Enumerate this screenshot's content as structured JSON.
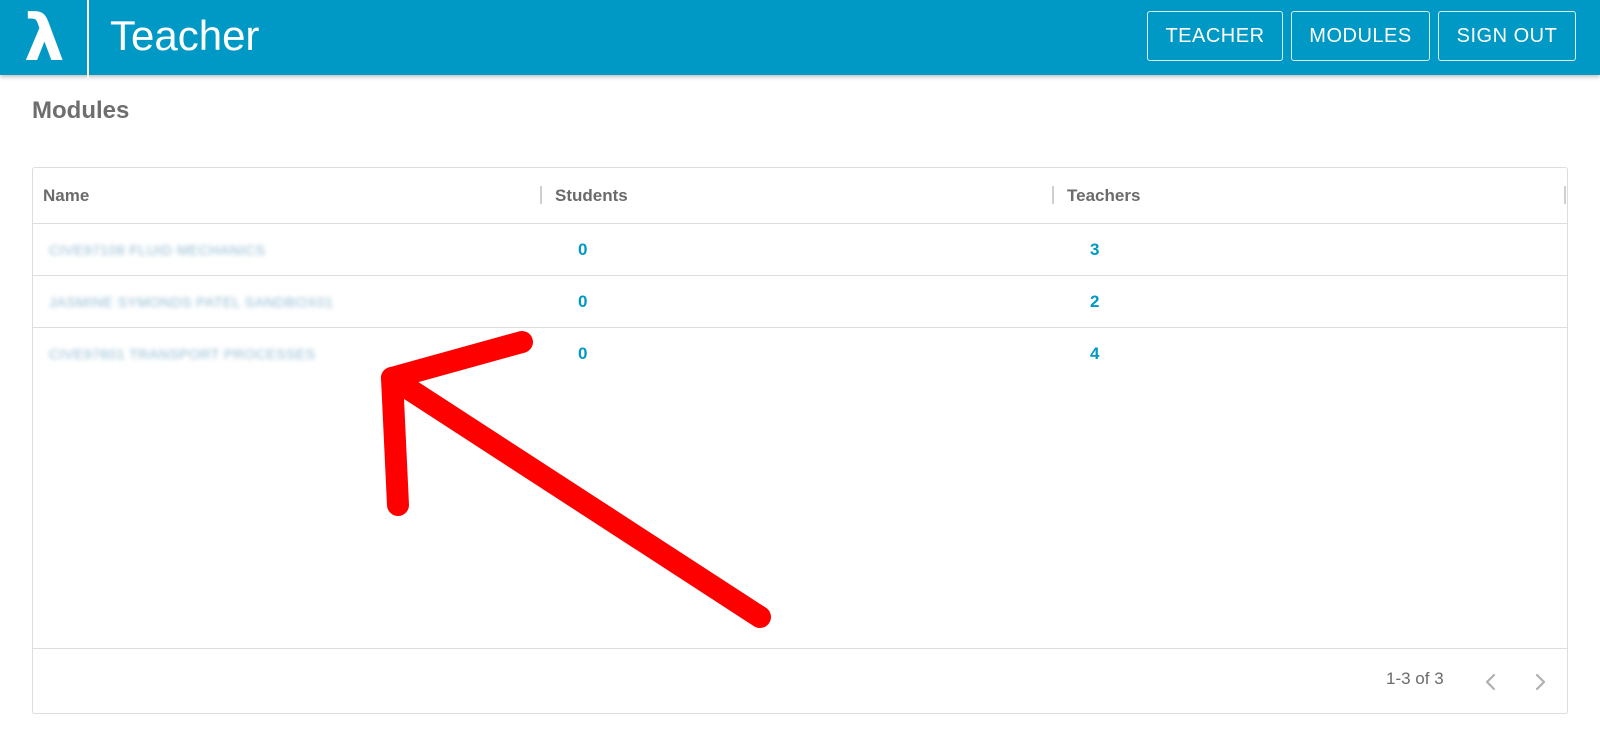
{
  "app": {
    "title": "Teacher",
    "logo_icon": "lambda-logo-icon",
    "brand_color": "#0099c6"
  },
  "nav": {
    "teacher_label": "TEACHER",
    "modules_label": "MODULES",
    "signout_label": "SIGN OUT"
  },
  "page": {
    "title": "Modules"
  },
  "table": {
    "columns": [
      "Name",
      "Students",
      "Teachers"
    ],
    "rows": [
      {
        "name": "CIVE97108 FLUID MECHANICS",
        "students": "0",
        "teachers": "3"
      },
      {
        "name": "JASMINE SYMONDS PATEL SANDBOX01",
        "students": "0",
        "teachers": "2"
      },
      {
        "name": "CIVE97601 TRANSPORT PROCESSES",
        "students": "0",
        "teachers": "4"
      }
    ],
    "pagination": {
      "range_text": "1-3 of 3",
      "prev_icon": "chevron-left-icon",
      "next_icon": "chevron-right-icon"
    }
  },
  "annotation": {
    "arrow_color": "#ff0000"
  }
}
